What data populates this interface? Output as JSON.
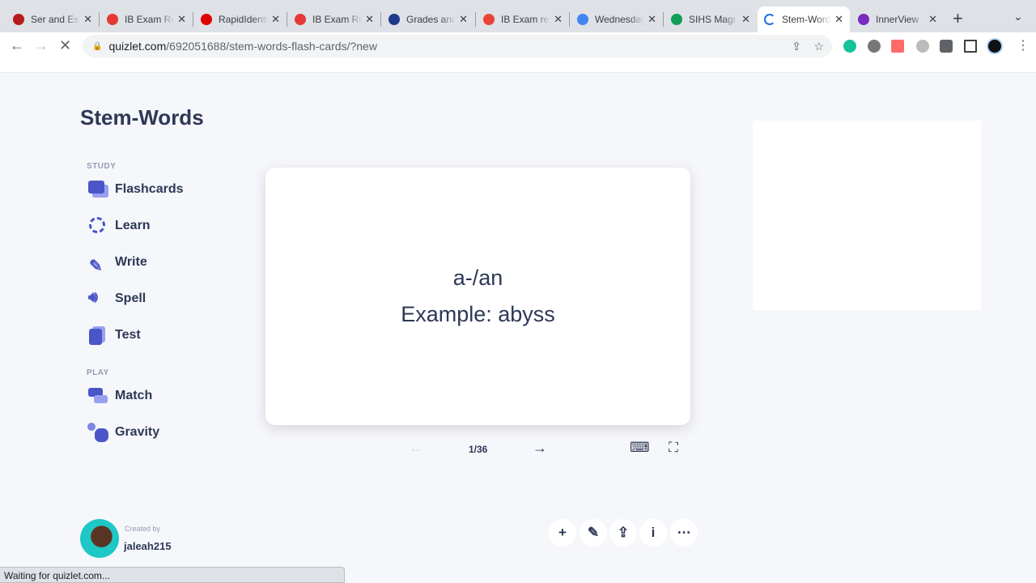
{
  "browser": {
    "tabs": [
      {
        "title": "Ser and Estar",
        "color": "#b71c1c"
      },
      {
        "title": "IB Exam Results",
        "color": "#e53935"
      },
      {
        "title": "RapidIdentity",
        "color": "#e00000"
      },
      {
        "title": "IB Exam Results",
        "color": "#e53935"
      },
      {
        "title": "Grades and",
        "color": "#1e3a8a"
      },
      {
        "title": "IB Exam re",
        "color": "#ea4335"
      },
      {
        "title": "Wednesday",
        "color": "#4285f4"
      },
      {
        "title": "SIHS Magi",
        "color": "#0f9d58"
      },
      {
        "title": "Stem-Words",
        "color": "#1a73e8",
        "active": true
      },
      {
        "title": "InnerView",
        "color": "#7b2cbf"
      }
    ],
    "url_host": "quizlet.com",
    "url_path": "/692051688/stem-words-flash-cards/?new",
    "status": "Waiting for quizlet.com..."
  },
  "page": {
    "title": "Stem-Words",
    "study_label": "STUDY",
    "play_label": "PLAY",
    "study_items": [
      "Flashcards",
      "Learn",
      "Write",
      "Spell",
      "Test"
    ],
    "play_items": [
      "Match",
      "Gravity"
    ],
    "card": {
      "term": "a-/an",
      "example": "Example: abyss"
    },
    "progress": "1/36",
    "created_by_label": "Created by",
    "creator": "jaleah215",
    "accent": "#4255ff"
  }
}
